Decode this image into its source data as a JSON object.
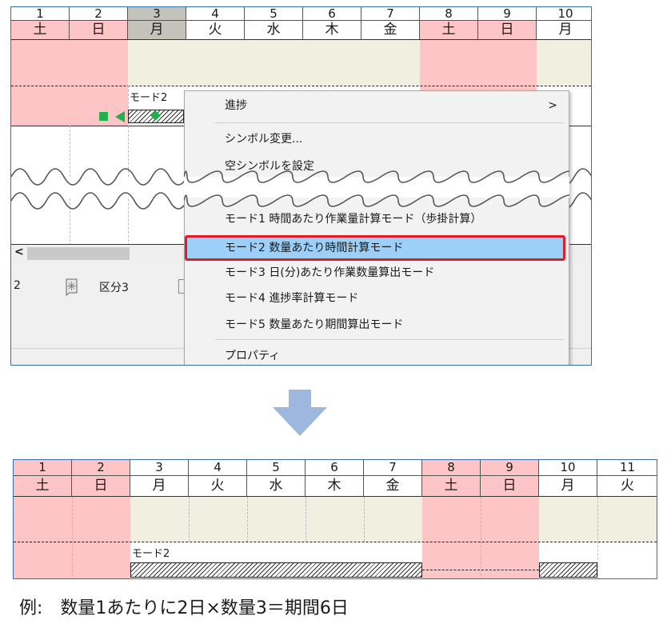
{
  "top_calendar": {
    "days": [
      {
        "num": "1",
        "dow": "土"
      },
      {
        "num": "2",
        "dow": "日"
      },
      {
        "num": "3",
        "dow": "月"
      },
      {
        "num": "4",
        "dow": "火"
      },
      {
        "num": "5",
        "dow": "水"
      },
      {
        "num": "6",
        "dow": "木"
      },
      {
        "num": "7",
        "dow": "金"
      },
      {
        "num": "8",
        "dow": "土"
      },
      {
        "num": "9",
        "dow": "日"
      },
      {
        "num": "10",
        "dow": "月"
      }
    ],
    "bar_label": "モード2",
    "scroll_left_arrow": "<",
    "bottom_row_index": "2",
    "bottom_row_label": "区分3"
  },
  "context_menu": {
    "items": {
      "progress": "進捗",
      "progress_arrow": ">",
      "change_symbol": "シンボル変更...",
      "set_empty_symbol": "空シンボルを設定",
      "mode1": "モード1 時間あたり作業量計算モード（歩掛計算）",
      "mode2": "モード2 数量あたり時間計算モード",
      "mode3": "モード3 日(分)あたり作業数量算出モード",
      "mode4": "モード4 進捗率計算モード",
      "mode5": "モード5 数量あたり期間算出モード",
      "properties": "プロパティ"
    }
  },
  "bottom_calendar": {
    "days": [
      {
        "num": "1",
        "dow": "土"
      },
      {
        "num": "2",
        "dow": "日"
      },
      {
        "num": "3",
        "dow": "月"
      },
      {
        "num": "4",
        "dow": "火"
      },
      {
        "num": "5",
        "dow": "水"
      },
      {
        "num": "6",
        "dow": "木"
      },
      {
        "num": "7",
        "dow": "金"
      },
      {
        "num": "8",
        "dow": "土"
      },
      {
        "num": "9",
        "dow": "日"
      },
      {
        "num": "10",
        "dow": "月"
      },
      {
        "num": "11",
        "dow": "火"
      }
    ],
    "bar_label": "モード2"
  },
  "caption": "例:　数量1あたりに2日×数量3＝期間6日",
  "colors": {
    "weekend": "#fdc5c5",
    "weekday_band": "#f1f0e0",
    "selected_col": "#c4c3bb",
    "highlight": "#9cd0f8",
    "highlight_border": "#e01b24",
    "arrow": "#9db7df",
    "marker_green": "#22b14c"
  }
}
